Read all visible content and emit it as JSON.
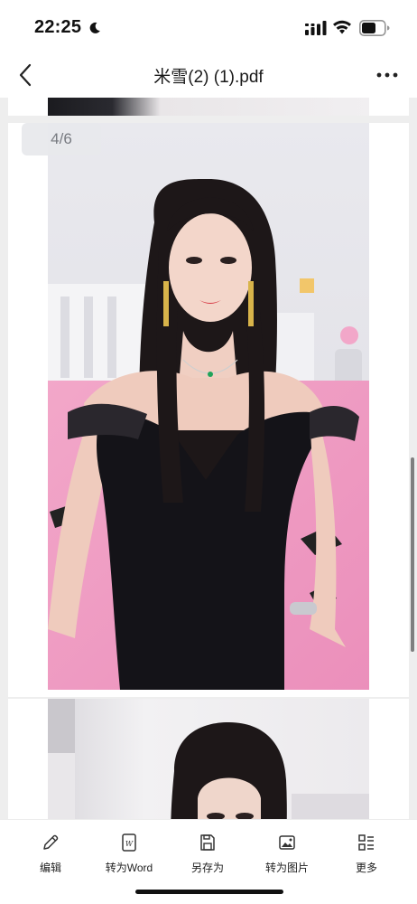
{
  "status_bar": {
    "time": "22:25",
    "icons": [
      "moon-icon",
      "cellular-signal-icon",
      "wifi-icon",
      "battery-icon"
    ]
  },
  "nav": {
    "title": "米雪(2) (1).pdf",
    "back_icon": "chevron-left-icon",
    "more_icon": "ellipsis-icon"
  },
  "viewer": {
    "page_indicator": "4/6",
    "background": "#eeeeee"
  },
  "toolbar": {
    "items": [
      {
        "label": "编辑",
        "icon": "pencil-icon"
      },
      {
        "label": "转为Word",
        "icon": "word-document-icon"
      },
      {
        "label": "另存为",
        "icon": "save-icon"
      },
      {
        "label": "转为图片",
        "icon": "image-icon"
      },
      {
        "label": "更多",
        "icon": "grid-more-icon"
      }
    ]
  }
}
